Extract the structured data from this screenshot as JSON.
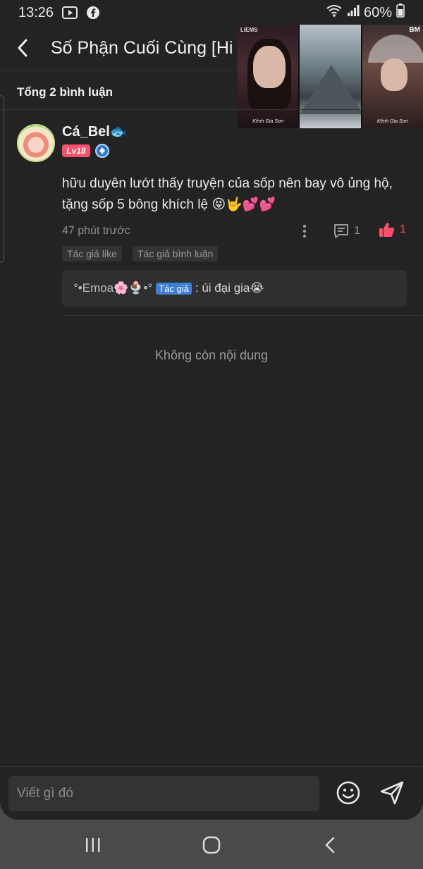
{
  "status_bar": {
    "time": "13:26",
    "battery": "60%",
    "icons": [
      "media-play-icon",
      "facebook-icon",
      "wifi-icon",
      "signal-icon",
      "battery-icon"
    ]
  },
  "header": {
    "title": "Số Phận Cuối Cùng [Hi"
  },
  "video_thumbs": {
    "label_left": "LIEMS",
    "label_right": "BM",
    "caption_1": "Kênh Gia Sơri",
    "caption_3": "Kênh Gia Sơri"
  },
  "comments_section": {
    "total_label": "Tổng 2 bình luận",
    "no_more_label": "Không còn nội dung"
  },
  "comment": {
    "username": "Cá_Bel🐟",
    "level": "Lv18",
    "text": "hữu duyên lướt thấy truyện của sốp nên bay vô ủng hộ, tặng sốp 5 bông khích lệ 😝🤟💕💕",
    "time": "47 phút trước",
    "reply_count": "1",
    "like_count": "1",
    "tags": [
      "Tác giả like",
      "Tác giả bình luận"
    ],
    "reply": {
      "author": "°•Emoa🌸🍨•°",
      "badge": "Tác giả",
      "text": ": úi đại gia😭"
    }
  },
  "composer": {
    "placeholder": "Viết gì đó"
  },
  "colors": {
    "background": "#232323",
    "accent_like": "#ff4f6a",
    "author_badge": "#3e7fd6"
  }
}
